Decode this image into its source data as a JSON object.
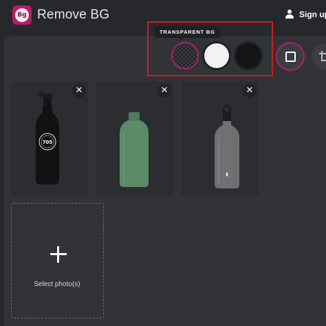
{
  "header": {
    "app_title": "Remove BG",
    "logo_text": "Bg",
    "signup_label": "Sign up"
  },
  "background_picker": {
    "tooltip": "TRANSPARENT BG",
    "options": [
      "transparent",
      "white",
      "black"
    ],
    "selected": "transparent"
  },
  "tools": {
    "selected": "frame"
  },
  "photos": {
    "items": [
      {
        "description": "black bottle with sport cap",
        "close_label": "✕"
      },
      {
        "description": "green bottle",
        "close_label": "✕"
      },
      {
        "description": "grey bottle with loop cap",
        "close_label": "✕"
      }
    ]
  },
  "upload": {
    "label": "Select photo(s)"
  },
  "colors": {
    "background": "#26282b",
    "panel": "#313337",
    "accent": "#b0206a",
    "highlight": "#cc1f24"
  }
}
